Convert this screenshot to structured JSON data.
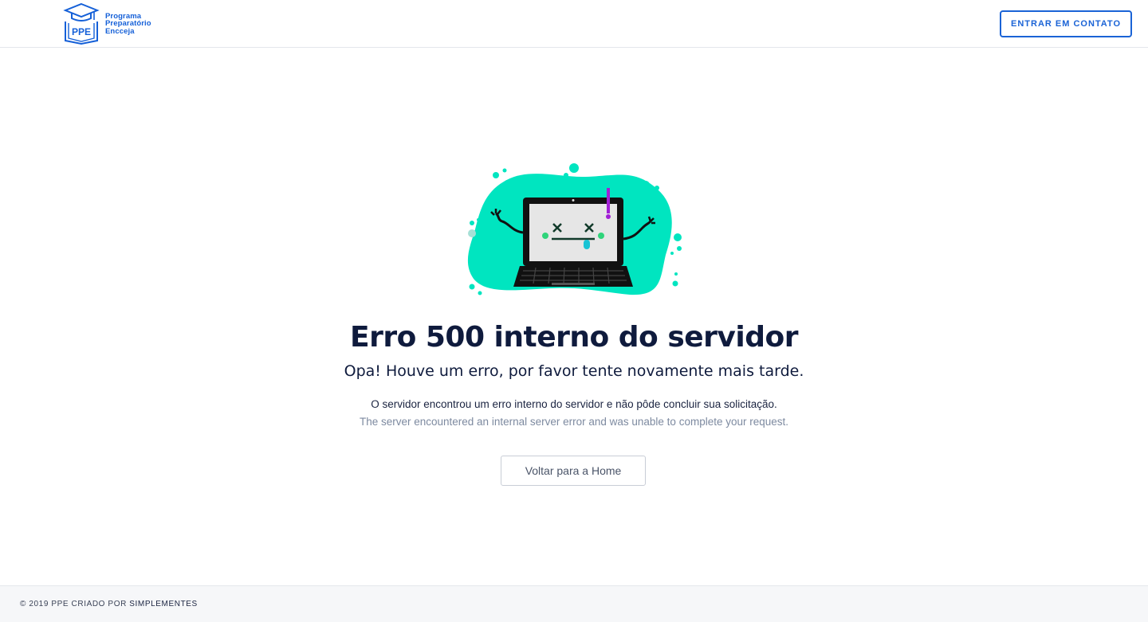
{
  "header": {
    "logo": {
      "badge": "PPE",
      "line1": "Programa",
      "line2": "Preparatório",
      "line3": "Encceja"
    },
    "contact_label": "ENTRAR EM CONTATO",
    "brand_color": "#1a63d6"
  },
  "main": {
    "title": "Erro 500 interno do servidor",
    "subtitle": "Opa! Houve um erro, por favor tente novamente mais tarde.",
    "description_pt": "O servidor encontrou um erro interno do servidor e não pôde concluir sua solicitação.",
    "description_en": "The server encountered an internal server error and was unable to complete your request.",
    "home_button": "Voltar para a Home",
    "illustration": {
      "icon": "broken-laptop-icon",
      "blob_color": "#00e5c0",
      "accent_color": "#a11fd6"
    }
  },
  "footer": {
    "text": "© 2019 PPE CRIADO POR ",
    "link": "SIMPLEMENTES"
  }
}
